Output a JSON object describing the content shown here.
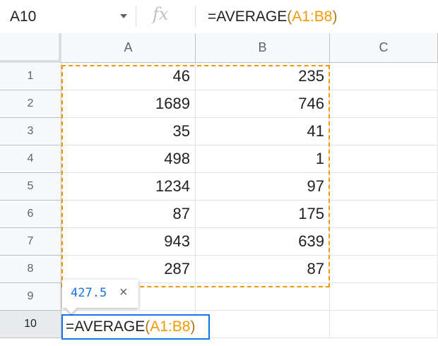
{
  "formula_bar": {
    "name_box": "A10",
    "fx_label": "fx",
    "formula_prefix": "=AVERAGE",
    "formula_open_paren": "(",
    "formula_ref": "A1:B8",
    "formula_close_paren": ")"
  },
  "columns": [
    "A",
    "B",
    "C"
  ],
  "rows": [
    "1",
    "2",
    "3",
    "4",
    "5",
    "6",
    "7",
    "8",
    "9",
    "10"
  ],
  "cells": {
    "A": [
      "46",
      "1689",
      "35",
      "498",
      "1234",
      "87",
      "943",
      "287"
    ],
    "B": [
      "235",
      "746",
      "41",
      "1",
      "97",
      "175",
      "639",
      "87"
    ]
  },
  "editor": {
    "prefix": "=AVERAGE",
    "open_paren": "(",
    "ref": "A1:B8",
    "close_paren": ")"
  },
  "tooltip": {
    "value": "427.5",
    "close_glyph": "×"
  },
  "colors": {
    "range_highlight": "#f29900",
    "active_border": "#1a73e8"
  }
}
